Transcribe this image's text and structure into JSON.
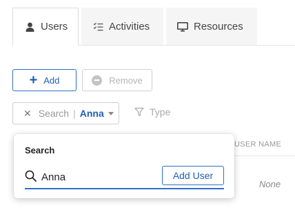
{
  "tabs": [
    {
      "label": "Users",
      "icon": "user-icon",
      "active": true
    },
    {
      "label": "Activities",
      "icon": "checklist-icon",
      "active": false
    },
    {
      "label": "Resources",
      "icon": "monitor-icon",
      "active": false
    }
  ],
  "toolbar": {
    "add_label": "Add",
    "remove_label": "Remove"
  },
  "filters": {
    "search_label": "Search",
    "search_separator": "|",
    "search_value": "Anna",
    "type_label": "Type"
  },
  "table": {
    "column_header": "USER NAME",
    "cell_value": "None"
  },
  "popover": {
    "title": "Search",
    "search_value": "Anna",
    "add_user_label": "Add User"
  },
  "colors": {
    "accent": "#1f5fb8",
    "border": "#cfcfcf",
    "disabled": "#b5b5b5"
  }
}
